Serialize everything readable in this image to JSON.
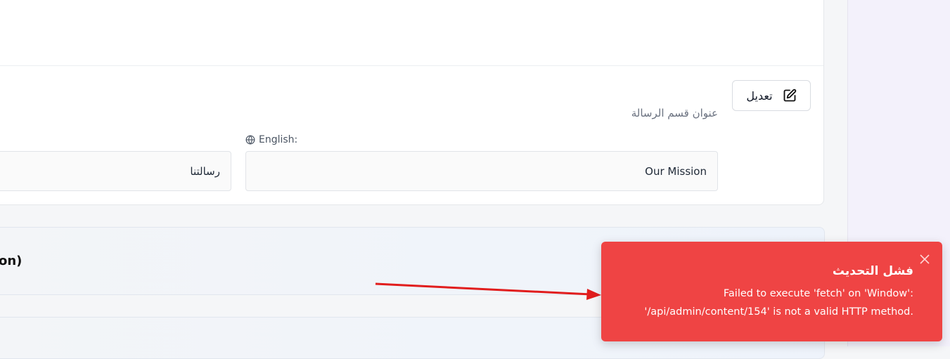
{
  "edit": {
    "label": "تعديل"
  },
  "section": {
    "title": "عنوان قسم الرسالة"
  },
  "english": {
    "label": "English:"
  },
  "fields": {
    "english_value": "Our Mission",
    "arabic_value": "رسالتنا"
  },
  "panel": {
    "title_fragment": "on)"
  },
  "toast": {
    "title": "فشل التحديث",
    "message_line1": "Failed to execute 'fetch' on 'Window':",
    "message_line2": "'/api/admin/content/154' is not a valid HTTP method.",
    "color": "#ef4444"
  },
  "annotation": {
    "arrow_color": "#e11d1d"
  }
}
